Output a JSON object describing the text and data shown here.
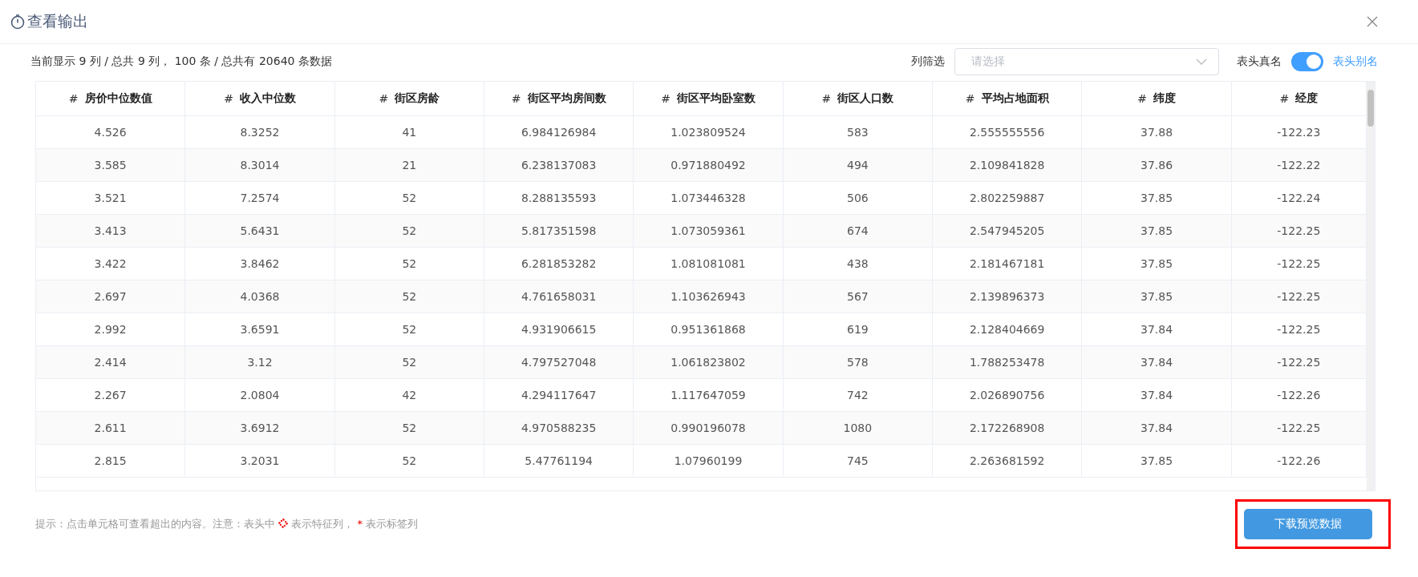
{
  "window": {
    "title": "查看输出"
  },
  "summary": "当前显示 9 列 / 总共 9 列， 100 条 / 总共有 20640 条数据",
  "column_filter": {
    "label": "列筛选",
    "placeholder": "请选择"
  },
  "header_toggle": {
    "off_label": "表头真名",
    "on_label": "表头别名",
    "on": true
  },
  "table": {
    "columns": [
      {
        "mark": "#",
        "name": "房价中位数值"
      },
      {
        "mark": "#",
        "name": "收入中位数"
      },
      {
        "mark": "#",
        "name": "街区房龄"
      },
      {
        "mark": "#",
        "name": "街区平均房间数"
      },
      {
        "mark": "#",
        "name": "街区平均卧室数"
      },
      {
        "mark": "#",
        "name": "街区人口数"
      },
      {
        "mark": "#",
        "name": "平均占地面积"
      },
      {
        "mark": "#",
        "name": "纬度"
      },
      {
        "mark": "#",
        "name": "经度"
      }
    ],
    "rows": [
      [
        "4.526",
        "8.3252",
        "41",
        "6.984126984",
        "1.023809524",
        "583",
        "2.555555556",
        "37.88",
        "-122.23"
      ],
      [
        "3.585",
        "8.3014",
        "21",
        "6.238137083",
        "0.971880492",
        "494",
        "2.109841828",
        "37.86",
        "-122.22"
      ],
      [
        "3.521",
        "7.2574",
        "52",
        "8.288135593",
        "1.073446328",
        "506",
        "2.802259887",
        "37.85",
        "-122.24"
      ],
      [
        "3.413",
        "5.6431",
        "52",
        "5.817351598",
        "1.073059361",
        "674",
        "2.547945205",
        "37.85",
        "-122.25"
      ],
      [
        "3.422",
        "3.8462",
        "52",
        "6.281853282",
        "1.081081081",
        "438",
        "2.181467181",
        "37.85",
        "-122.25"
      ],
      [
        "2.697",
        "4.0368",
        "52",
        "4.761658031",
        "1.103626943",
        "567",
        "2.139896373",
        "37.85",
        "-122.25"
      ],
      [
        "2.992",
        "3.6591",
        "52",
        "4.931906615",
        "0.951361868",
        "619",
        "2.128404669",
        "37.84",
        "-122.25"
      ],
      [
        "2.414",
        "3.12",
        "52",
        "4.797527048",
        "1.061823802",
        "578",
        "1.788253478",
        "37.84",
        "-122.25"
      ],
      [
        "2.267",
        "2.0804",
        "42",
        "4.294117647",
        "1.117647059",
        "742",
        "2.026890756",
        "37.84",
        "-122.26"
      ],
      [
        "2.611",
        "3.6912",
        "52",
        "4.970588235",
        "0.990196078",
        "1080",
        "2.172268908",
        "37.84",
        "-122.25"
      ],
      [
        "2.815",
        "3.2031",
        "52",
        "5.47761194",
        "1.07960199",
        "745",
        "2.263681592",
        "37.85",
        "-122.26"
      ]
    ]
  },
  "hint": {
    "text_before": "提示：点击单元格可查看超出的内容。注意：表头中",
    "text_middle": "表示特征列，",
    "star": "*",
    "text_after": "表示标签列"
  },
  "download_button": "下载预览数据"
}
